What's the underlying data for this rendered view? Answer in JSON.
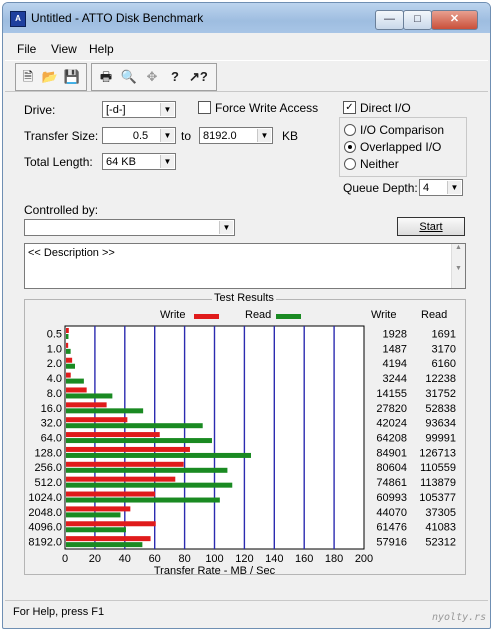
{
  "window": {
    "title": "Untitled - ATTO Disk Benchmark",
    "min_label": "—",
    "max_label": "□",
    "close_label": "✕"
  },
  "menu": [
    "File",
    "View",
    "Help"
  ],
  "toolbar": [
    "new-icon",
    "open-icon",
    "save-icon",
    "print-icon",
    "print-preview-icon",
    "move-icon",
    "help-icon",
    "context-help-icon"
  ],
  "form": {
    "drive_label": "Drive:",
    "drive_value": "[-d-]",
    "force_write_label": "Force Write Access",
    "force_write_checked": false,
    "direct_io_label": "Direct I/O",
    "direct_io_checked": true,
    "transfer_label": "Transfer Size:",
    "transfer_from": "0.5",
    "to_label": "to",
    "transfer_to": "8192.0",
    "kb_label": "KB",
    "length_label": "Total Length:",
    "length_value": "64 KB",
    "io_comparison_label": "I/O Comparison",
    "overlapped_label": "Overlapped I/O",
    "neither_label": "Neither",
    "selected_mode": "overlapped",
    "queue_label": "Queue Depth:",
    "queue_value": "4",
    "controlled_label": "Controlled by:",
    "controlled_value": "",
    "start_label": "Start",
    "description": "<< Description >>"
  },
  "results": {
    "group_title": "Test Results",
    "write_legend": "Write",
    "read_legend": "Read",
    "write_col": "Write",
    "read_col": "Read"
  },
  "chart_data": {
    "type": "bar",
    "orientation": "horizontal",
    "xlabel": "Transfer Rate - MB / Sec",
    "xlim": [
      0,
      200
    ],
    "xticks": [
      0,
      20,
      40,
      60,
      80,
      100,
      120,
      140,
      160,
      180,
      200
    ],
    "categories": [
      "0.5",
      "1.0",
      "2.0",
      "4.0",
      "8.0",
      "16.0",
      "32.0",
      "64.0",
      "128.0",
      "256.0",
      "512.0",
      "1024.0",
      "2048.0",
      "4096.0",
      "8192.0"
    ],
    "colors": {
      "write": "#e01b1b",
      "read": "#1a8a22",
      "grid": "#2b2bb0"
    },
    "series": [
      {
        "name": "Write",
        "values": [
          1928,
          1487,
          4194,
          3244,
          14155,
          27820,
          42024,
          64208,
          84901,
          80604,
          74861,
          60993,
          44070,
          61476,
          57916
        ]
      },
      {
        "name": "Read",
        "values": [
          1691,
          3170,
          6160,
          12238,
          31752,
          52838,
          93634,
          99991,
          126713,
          110559,
          113879,
          105377,
          37305,
          41083,
          52312
        ]
      }
    ],
    "value_unit_note": "KB/s values shown in columns; bars plotted in MB/s"
  },
  "status": {
    "text": "For Help, press F1"
  },
  "watermark": "nyolty.rs"
}
